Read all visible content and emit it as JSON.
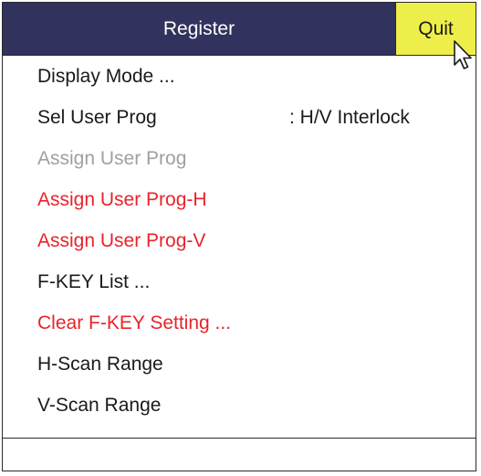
{
  "title_bar": {
    "title": "Register",
    "quit_label": "Quit"
  },
  "menu": {
    "items": [
      {
        "label": "Display Mode ...",
        "state": "normal"
      },
      {
        "label": "Sel User Prog",
        "value": ": H/V Interlock",
        "state": "normal"
      },
      {
        "label": "Assign User Prog",
        "state": "disabled"
      },
      {
        "label": "Assign User Prog-H",
        "state": "highlight"
      },
      {
        "label": "Assign User Prog-V",
        "state": "highlight"
      },
      {
        "label": "F-KEY List ...",
        "state": "normal"
      },
      {
        "label": "Clear F-KEY Setting ...",
        "state": "highlight"
      },
      {
        "label": "H-Scan Range",
        "state": "normal"
      },
      {
        "label": "V-Scan Range",
        "state": "normal"
      }
    ]
  },
  "colors": {
    "title_bar_bg": "#32325e",
    "quit_button_bg": "#eeee4a",
    "highlight_text": "#e8242a",
    "disabled_text": "#a0a0a0",
    "normal_text": "#1a1a1a"
  },
  "icons": {
    "cursor": "mouse-pointer-arrow-icon"
  }
}
